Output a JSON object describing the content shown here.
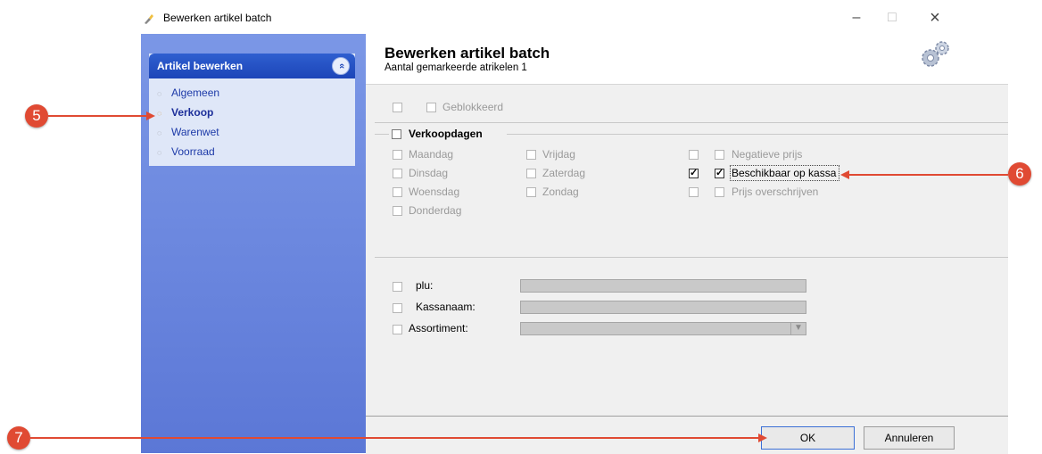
{
  "window": {
    "title": "Bewerken artikel batch",
    "minimize": "–",
    "maximize": "□",
    "close": "×"
  },
  "sidebar": {
    "header": "Artikel bewerken",
    "collapse_glyph": "«",
    "items": [
      {
        "label": "Algemeen"
      },
      {
        "label": "Verkoop"
      },
      {
        "label": "Warenwet"
      },
      {
        "label": "Voorraad"
      }
    ]
  },
  "main": {
    "title": "Bewerken artikel batch",
    "subtitle": "Aantal gemarkeerde atrikelen 1",
    "geblokkeerd": "Geblokkeerd",
    "verkoopdagen_label": "Verkoopdagen",
    "days_col1": [
      "Maandag",
      "Dinsdag",
      "Woensdag",
      "Donderdag"
    ],
    "days_col2": [
      "Vrijdag",
      "Zaterdag",
      "Zondag"
    ],
    "options": [
      {
        "label": "Negatieve prijs",
        "enabled": false,
        "checked": false
      },
      {
        "label": "Beschikbaar op kassa",
        "enabled": true,
        "checked": true
      },
      {
        "label": "Prijs overschrijven",
        "enabled": false,
        "checked": false
      }
    ],
    "fields": [
      {
        "label": "plu:",
        "value": ""
      },
      {
        "label": "Kassanaam:",
        "value": ""
      },
      {
        "label": "Assortiment:",
        "value": ""
      }
    ],
    "combo_arrow": "▼"
  },
  "footer": {
    "ok": "OK",
    "cancel": "Annuleren"
  },
  "annotations": {
    "five": "5",
    "six": "6",
    "seven": "7",
    "color": "#e04a33"
  }
}
